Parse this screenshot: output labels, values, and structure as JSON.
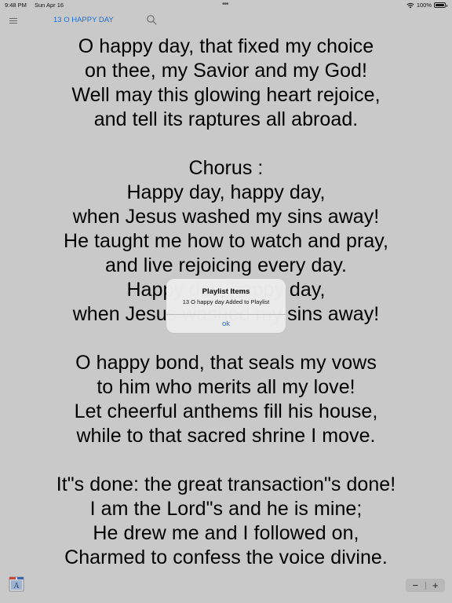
{
  "status_bar": {
    "time": "9:48 PM",
    "date": "Sun Apr 16",
    "battery": "100%"
  },
  "nav": {
    "title": "13 O HAPPY DAY",
    "menu_icon": "hamburger-menu-icon",
    "search_icon": "search-icon"
  },
  "lyrics": {
    "verse1": [
      "O happy day, that fixed my choice",
      "on thee, my Savior and my God!",
      "Well may this glowing heart rejoice,",
      "and tell its raptures all abroad."
    ],
    "chorus": [
      "Chorus :",
      "Happy day, happy day,",
      "when Jesus washed my sins away!",
      "He taught me how to watch and pray,",
      "and live rejoicing every day.",
      "Happy day, happy day,",
      "when Jesus washed my sins away!"
    ],
    "verse2": [
      "O happy bond, that seals my vows",
      "to him who merits all my love!",
      "Let cheerful anthems fill his house,",
      "while to that sacred shrine I move."
    ],
    "verse3": [
      "It\"s done: the great transaction\"s done!",
      "I am the Lord\"s and he is mine;",
      "He drew me and I followed on,",
      "Charmed to confess the voice divine."
    ]
  },
  "alert": {
    "title": "Playlist Items",
    "message": "13 O happy day Added to Playlist",
    "button": "ok"
  },
  "stepper": {
    "minus": "−",
    "plus": "+"
  },
  "colors": {
    "background": "#c9c9c9",
    "accent": "#1b6ed6"
  }
}
